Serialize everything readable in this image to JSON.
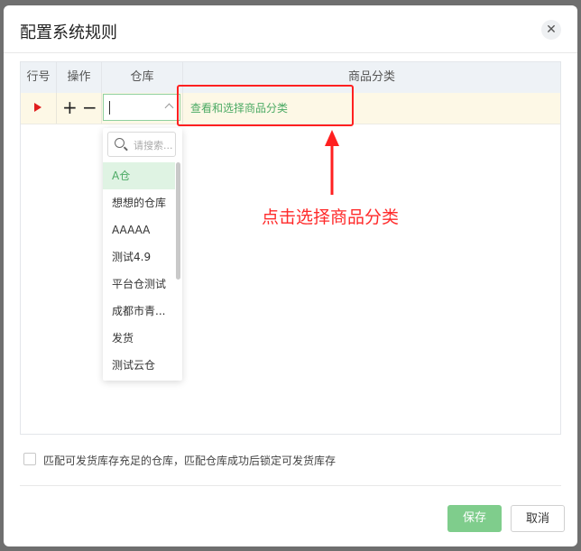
{
  "dialog": {
    "title": "配置系统规则",
    "close_icon": "close-icon"
  },
  "table": {
    "headers": [
      "行号",
      "操作",
      "仓库",
      "商品分类"
    ],
    "row": {
      "indicator_icon": "play-icon",
      "add_label": "+",
      "remove_label": "−",
      "warehouse_value": "",
      "category_link": "查看和选择商品分类"
    }
  },
  "dropdown": {
    "search_placeholder": "请搜索...",
    "options": [
      "A仓",
      "想想的仓库",
      "AAAAA",
      "测试4.9",
      "平台仓测试",
      "成都市青...",
      "发货",
      "测试云仓"
    ],
    "selected": "A仓"
  },
  "annotation": {
    "text": "点击选择商品分类"
  },
  "footer": {
    "checkbox_label": "匹配可发货库存充足的仓库，匹配仓库成功后锁定可发货库存",
    "checkbox_checked": false,
    "save_label": "保存",
    "cancel_label": "取消"
  },
  "colors": {
    "primary": "#7fcd8c",
    "link": "#4caa64",
    "annotation": "#ff2a2a",
    "row_highlight": "#fdf8e6"
  }
}
